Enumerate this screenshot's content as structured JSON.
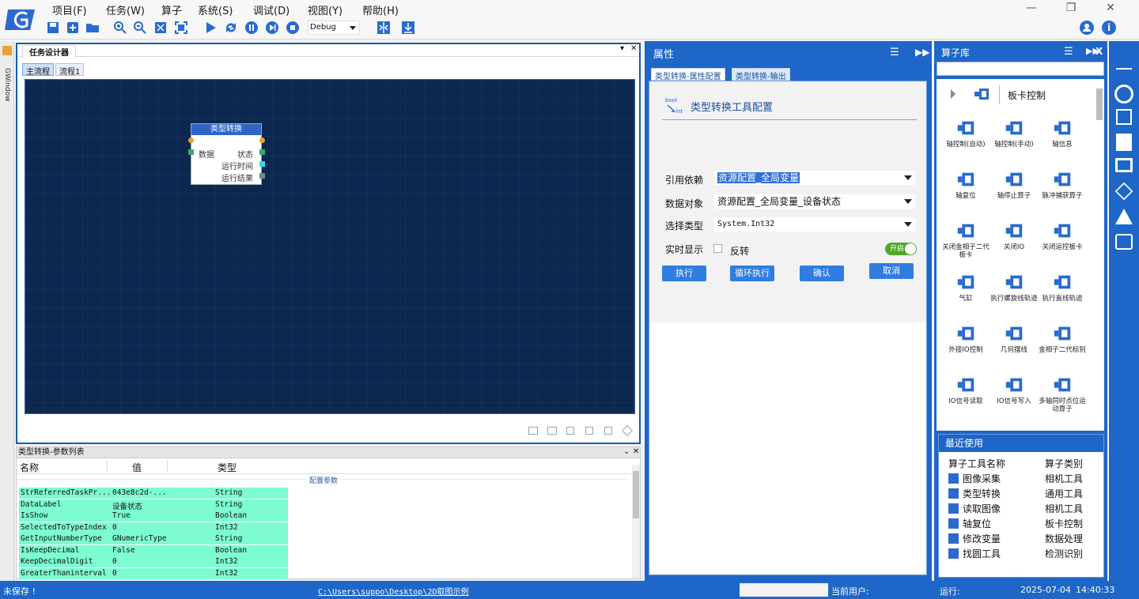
{
  "menu": [
    "项目(F)",
    "任务(W)",
    "算子",
    "系统(S)",
    "调试(D)",
    "视图(Y)",
    "帮助(H)"
  ],
  "toolbar": {
    "debug_value": "Debug"
  },
  "left_strip_label": "GWindow",
  "designer": {
    "title": "任务设计器",
    "pin": "▾",
    "close": "✕",
    "tabs": [
      "主流程",
      "流程1"
    ],
    "node": {
      "title": "类型转换",
      "left_ports": [
        "数据"
      ],
      "right_ports": [
        "状态",
        "运行时间",
        "运行结果"
      ]
    }
  },
  "params": {
    "title": "类型转换-参数列表",
    "columns": [
      "名称",
      "值",
      "类型"
    ],
    "group": "配置参数",
    "rows": [
      {
        "name": "StrReferredTaskPr...",
        "value": "043e8c2d-...",
        "type": "String"
      },
      {
        "name": "DataLabel",
        "value": "设备状态",
        "type": "String"
      },
      {
        "name": "IsShow",
        "value": "True",
        "type": "Boolean"
      },
      {
        "name": "SelectedToTypeIndex",
        "value": "0",
        "type": "Int32"
      },
      {
        "name": "GetInputNumberType",
        "value": "GNumericType",
        "type": "String"
      },
      {
        "name": "IsKeepDecimal",
        "value": "False",
        "type": "Boolean"
      },
      {
        "name": "KeepDecimalDigit",
        "value": "0",
        "type": "Int32"
      },
      {
        "name": "GreaterThaninterval",
        "value": "0",
        "type": "Int32"
      }
    ]
  },
  "props": {
    "title": "属性",
    "tabs": [
      "类型转换-属性配置",
      "类型转换-输出"
    ],
    "heading": "类型转换工具配置",
    "icon_text": "bool\nint",
    "fields": [
      {
        "label": "引用依赖",
        "value": "资源配置_全局变量"
      },
      {
        "label": "数据对象",
        "value": "资源配置_全局变量_设备状态"
      },
      {
        "label": "选择类型",
        "value": "System.Int32"
      }
    ],
    "realtime_label": "实时显示",
    "invert_label": "反转",
    "toggle_label": "开启",
    "buttons": [
      "执行",
      "循环执行",
      "确认",
      "取消"
    ]
  },
  "library": {
    "title": "算子库",
    "close": "X",
    "category": "板卡控制",
    "items": [
      "轴控制(自动)",
      "轴控制(手动)",
      "轴信息",
      "轴复位",
      "轴停止算子",
      "脉冲捕获算子",
      "关闭金相子二代板卡",
      "关闭IO",
      "关闭运控板卡",
      "气缸",
      "执行螺旋线轨迹",
      "执行直线轨迹",
      "外接IO控制",
      "几何摆线",
      "金相子二代标别",
      "IO信号读取",
      "IO信号写入",
      "多轴同时点位运动算子"
    ],
    "recent_title": "最近使用",
    "recent_header": [
      "算子工具名称",
      "算子类别"
    ],
    "recent": [
      {
        "name": "图像采集",
        "cat": "相机工具"
      },
      {
        "name": "类型转换",
        "cat": "通用工具"
      },
      {
        "name": "读取图像",
        "cat": "相机工具"
      },
      {
        "name": "轴复位",
        "cat": "板卡控制"
      },
      {
        "name": "修改变量",
        "cat": "数据处理"
      },
      {
        "name": "找圆工具",
        "cat": "检测识别"
      }
    ]
  },
  "status": {
    "save_state": "未保存 !",
    "path": "C:\\Users\\suppo\\Desktop\\2D取图示例",
    "user_label": "当前用户:",
    "run_label": "运行:",
    "date": "2025-07-04",
    "time": "14:40:33"
  },
  "colors": {
    "brand": "#1e66c8",
    "canvas": "#0d2850",
    "param_row": "#7dfcd1"
  }
}
